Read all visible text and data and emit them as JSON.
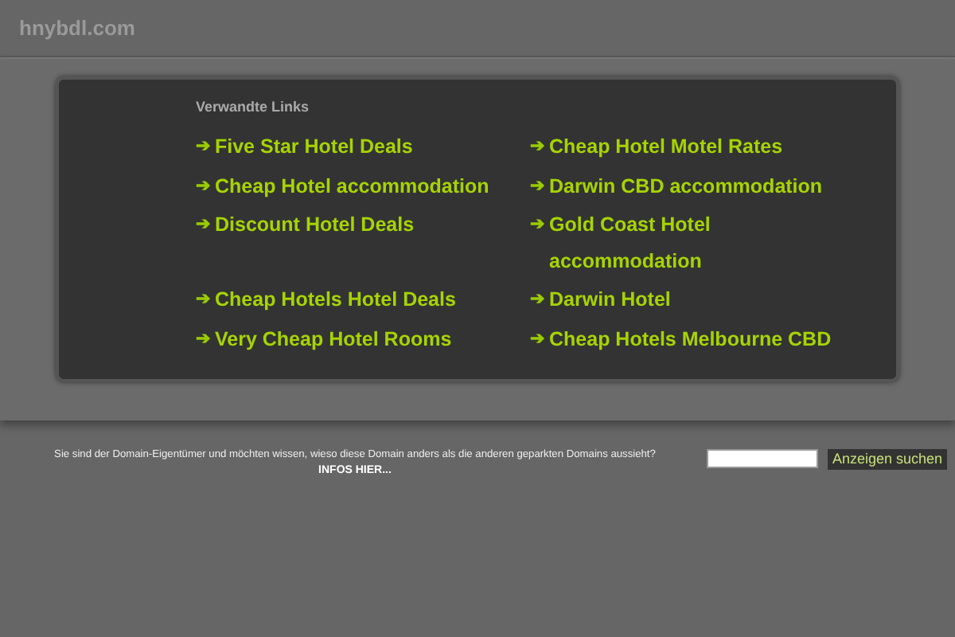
{
  "site": {
    "title": "hnybdl.com"
  },
  "related": {
    "heading": "Verwandte Links",
    "links": [
      {
        "arrow": "➔",
        "label": "Five Star Hotel Deals"
      },
      {
        "arrow": "➔",
        "label": "Cheap Hotel Motel Rates"
      },
      {
        "arrow": "➔",
        "label": "Cheap Hotel accommodation"
      },
      {
        "arrow": "➔",
        "label": "Darwin CBD accommodation"
      },
      {
        "arrow": "➔",
        "label": "Discount Hotel Deals"
      },
      {
        "arrow": "➔",
        "label": "Gold Coast Hotel accommodation"
      },
      {
        "arrow": "➔",
        "label": "Cheap Hotels Hotel Deals"
      },
      {
        "arrow": "➔",
        "label": "Darwin Hotel"
      },
      {
        "arrow": "➔",
        "label": "Very Cheap Hotel Rooms"
      },
      {
        "arrow": "➔",
        "label": "Cheap Hotels Melbourne CBD"
      }
    ]
  },
  "footer": {
    "question": "Sie sind der Domain-Eigentümer und möchten wissen, wieso diese Domain anders als die anderen geparkten Domains aussieht?",
    "info_link": "INFOS HIER...",
    "search_button": "Anzeigen suchen"
  }
}
